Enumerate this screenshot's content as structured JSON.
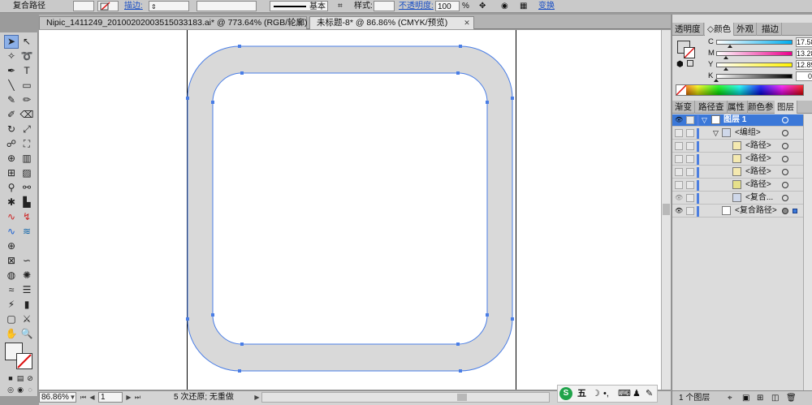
{
  "control_bar": {
    "object_type": "复合路径",
    "stroke_label": "描边:",
    "stroke_style": "基本",
    "style_label": "样式:",
    "opacity_label": "不透明度:",
    "opacity_value": "100",
    "opacity_unit": "%",
    "transform_label": "变换"
  },
  "tabs": [
    {
      "label": "Nipic_1411249_20100202003515033183.ai* @ 773.64% (RGB/轮廓)",
      "active": false
    },
    {
      "label": "未标题-8* @ 86.86% (CMYK/预览)",
      "active": true
    }
  ],
  "status": {
    "zoom": "86.86%",
    "page": "1",
    "history": "5 次还原; 无重做"
  },
  "panel_tabs_top": [
    {
      "label": "透明度",
      "selected": false
    },
    {
      "label": "◇颜色",
      "selected": true
    },
    {
      "label": "外观",
      "selected": false
    },
    {
      "label": "描边",
      "selected": false
    }
  ],
  "color": {
    "channels": [
      {
        "label": "C",
        "value": "17.58",
        "unit": "%",
        "fraction": 0.1758
      },
      {
        "label": "M",
        "value": "13.28",
        "unit": "%",
        "fraction": 0.1328
      },
      {
        "label": "Y",
        "value": "12.89",
        "unit": "%",
        "fraction": 0.1289
      },
      {
        "label": "K",
        "value": "0",
        "unit": "%",
        "fraction": 0.0
      }
    ]
  },
  "panel_tabs_bottom": [
    {
      "label": "渐变",
      "selected": false
    },
    {
      "label": "路径查",
      "selected": false
    },
    {
      "label": "属性",
      "selected": false
    },
    {
      "label": "颜色参",
      "selected": false
    },
    {
      "label": "图层",
      "selected": true
    }
  ],
  "layers": [
    {
      "name": "图层 1",
      "selected": true,
      "visible": true
    },
    {
      "name": "<编组>",
      "selected": false,
      "visible": false
    },
    {
      "name": "<路径>",
      "selected": false,
      "visible": false
    },
    {
      "name": "<路径>",
      "selected": false,
      "visible": false
    },
    {
      "name": "<路径>",
      "selected": false,
      "visible": false
    },
    {
      "name": "<路径>",
      "selected": false,
      "visible": false
    },
    {
      "name": "<复合...",
      "selected": false,
      "visible": true
    },
    {
      "name": "<复合路径>",
      "selected": false,
      "visible": true
    }
  ],
  "layers_footer": "1 个图层",
  "ime": {
    "brand": "S",
    "mode": "五"
  },
  "colors": {
    "accent": "#3b78d8",
    "shape_fill": "#d9d9d9",
    "path_stroke": "#4a7ee6"
  }
}
